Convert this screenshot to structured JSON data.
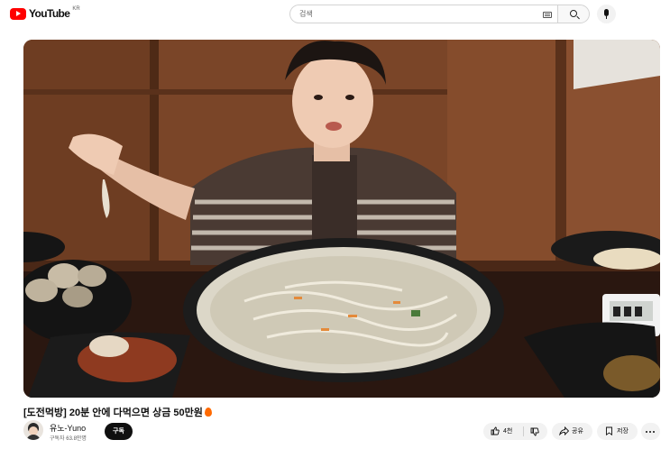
{
  "header": {
    "logo_text": "YouTube",
    "country_code": "KR",
    "search": {
      "placeholder": "검색"
    }
  },
  "video": {
    "title": "[도전먹방] 20분 안에 다먹으면 상금 50만원",
    "title_emoji_icon": "fire-icon"
  },
  "channel": {
    "name": "유노-Yuno",
    "subscribers": "구독자 63.8만명",
    "subscribe_label": "구독"
  },
  "actions": {
    "likes": "4천",
    "share_label": "공유",
    "save_label": "저장"
  },
  "colors": {
    "brand_red": "#ff0000",
    "subscribe_bg": "#0f0f0f",
    "pill_bg": "#f2f2f2"
  }
}
